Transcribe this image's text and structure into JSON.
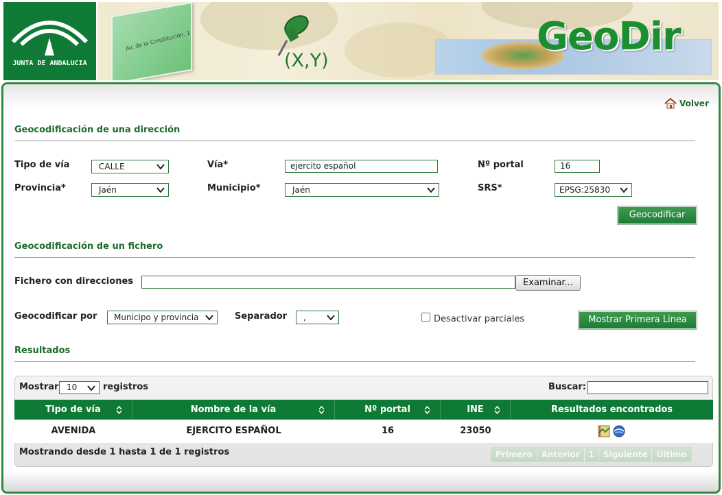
{
  "header": {
    "logo_text": "JUNTA DE ANDALUCIA",
    "app_name": "GeoDir",
    "coords_label": "(X,Y)",
    "card_text": "Av. de la Constitución, 1"
  },
  "nav": {
    "back_label": "Volver"
  },
  "address_section": {
    "title": "Geocodificación de una dirección",
    "tipo_via_label": "Tipo de vía",
    "tipo_via_value": "CALLE",
    "via_label": "Vía*",
    "via_value": "ejercito español",
    "portal_label": "Nº portal",
    "portal_value": "16",
    "provincia_label": "Provincia*",
    "provincia_value": "Jaén",
    "municipio_label": "Municipio*",
    "municipio_value": "Jaén",
    "srs_label": "SRS*",
    "srs_value": "EPSG:25830",
    "geocode_button": "Geocodificar"
  },
  "file_section": {
    "title": "Geocodificación de un fichero",
    "file_label": "Fichero con direcciones",
    "file_value": "",
    "browse_button": "Examinar...",
    "geocode_by_label": "Geocodificar por",
    "geocode_by_value": "Municipo y provincia",
    "separator_label": "Separador",
    "separator_value": ",",
    "disable_partial_label": "Desactivar parciales",
    "disable_partial_checked": false,
    "show_first_line_button": "Mostrar Primera Linea"
  },
  "results_section": {
    "title": "Resultados",
    "show_label": "Mostrar",
    "page_size": "10",
    "records_label": "registros",
    "search_label": "Buscar:",
    "search_value": "",
    "columns": [
      "Tipo de vía",
      "Nombre de la vía",
      "Nº portal",
      "INE",
      "Resultados encontrados"
    ],
    "rows": [
      {
        "tipo": "AVENIDA",
        "nombre": "EJERCITO ESPAÑOL",
        "portal": "16",
        "ine": "23050"
      }
    ],
    "info": "Mostrando desde 1 hasta 1 de 1 registros",
    "pagination": {
      "first": "Primero",
      "prev": "Anterior",
      "current": "1",
      "next": "Siguiente",
      "last": "Último"
    }
  },
  "colors": {
    "brand_green": "#0f7a35",
    "title_green": "#1e6b2b"
  }
}
